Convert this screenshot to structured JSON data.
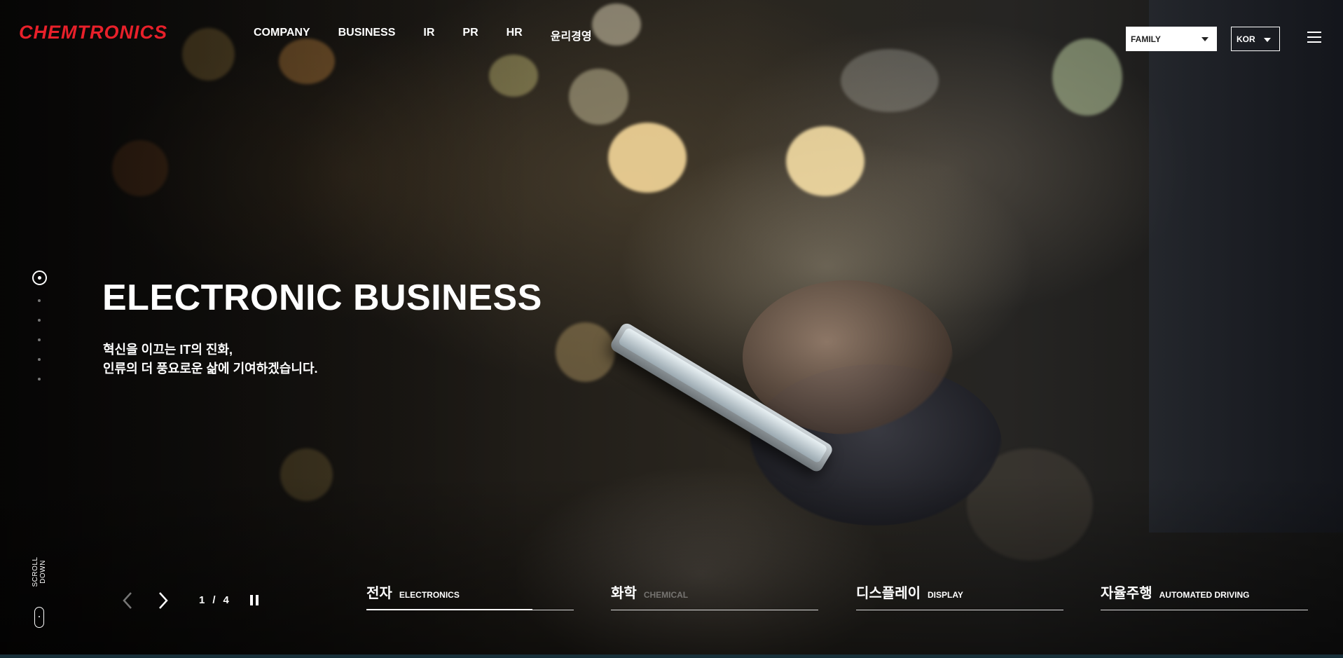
{
  "header": {
    "logo": "CHEMTRONICS",
    "nav": [
      "COMPANY",
      "BUSINESS",
      "IR",
      "PR",
      "HR",
      "윤리경영"
    ],
    "family_select": "FAMILY",
    "lang_select": "KOR",
    "menu_icon": "hamburger-icon"
  },
  "hero": {
    "title": "ELECTRONIC BUSINESS",
    "desc_line1": "혁신을 이끄는 IT의 진화,",
    "desc_line2": "인류의 더 풍요로운 삶에 기여하겠습니다."
  },
  "pager": {
    "count": 6,
    "active_index": 0
  },
  "scroll": {
    "label": "SCROLL DOWN"
  },
  "slider": {
    "current": "1",
    "separator": "/",
    "total": "4",
    "prev_icon": "chevron-left-icon",
    "next_icon": "chevron-right-icon",
    "pause_icon": "pause-icon"
  },
  "categories": [
    {
      "ko": "전자",
      "en": "ELECTRONICS",
      "progress": 0.8
    },
    {
      "ko": "화학",
      "en": "CHEMICAL",
      "progress": 0
    },
    {
      "ko": "디스플레이",
      "en": "DISPLAY",
      "progress": 0
    },
    {
      "ko": "자율주행",
      "en": "AUTOMATED DRIVING",
      "progress": 0
    }
  ],
  "colors": {
    "brand": "#e8202a",
    "accent_bar": "#18303a"
  }
}
